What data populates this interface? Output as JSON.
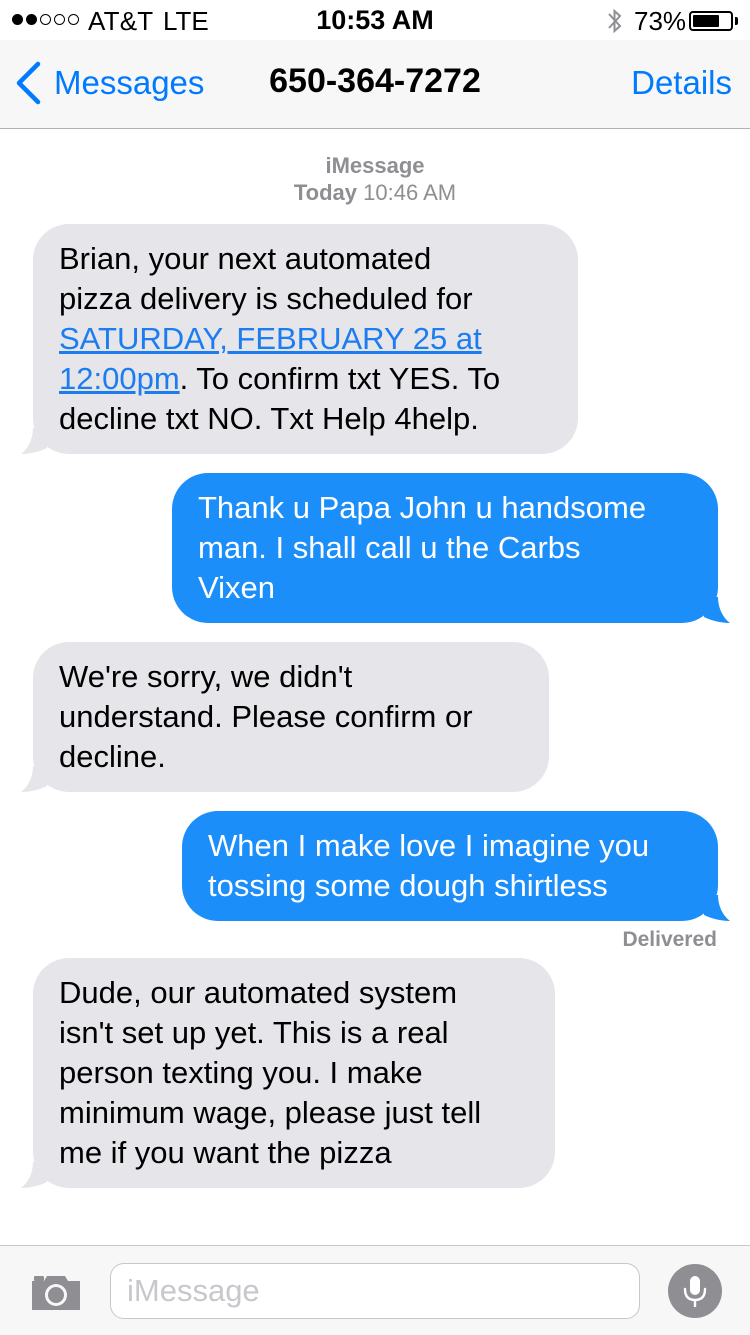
{
  "status_bar": {
    "carrier": "AT&T",
    "network": "LTE",
    "time": "10:53 AM",
    "battery_percent": "73%",
    "battery_level": 0.73,
    "signal_bars": 2,
    "signal_total": 5,
    "icons": [
      "signal-dots-icon",
      "bluetooth-icon",
      "battery-icon"
    ]
  },
  "nav": {
    "back_label": "Messages",
    "title": "650-364-7272",
    "details_label": "Details",
    "icons": [
      "back-chevron-icon"
    ]
  },
  "thread": {
    "service": "iMessage",
    "timestamp_day": "Today",
    "timestamp_time": "10:46 AM",
    "messages": [
      {
        "direction": "incoming",
        "lines": [
          "Brian, your next automated",
          "pizza delivery is scheduled for"
        ],
        "link_lines": [
          "SATURDAY, FEBRUARY 25 at",
          "12:00pm"
        ],
        "after_link": ". To confirm txt YES. To",
        "tail_lines": [
          "decline txt NO. Txt Help 4help."
        ]
      },
      {
        "direction": "outgoing",
        "lines": [
          "Thank u Papa John u handsome",
          "man. I shall call u the Carbs",
          "Vixen"
        ]
      },
      {
        "direction": "incoming",
        "lines": [
          "We're sorry, we didn't",
          "understand. Please confirm or",
          "decline."
        ]
      },
      {
        "direction": "outgoing",
        "lines": [
          "When I make love I imagine you",
          "tossing some dough shirtless"
        ]
      },
      {
        "direction": "incoming",
        "lines": [
          "Dude, our automated system",
          "isn't set up yet. This is a real",
          "person texting you. I make",
          "minimum wage, please just tell",
          "me if you want the pizza"
        ]
      }
    ],
    "delivered_label": "Delivered"
  },
  "input_bar": {
    "placeholder": "iMessage",
    "value": "",
    "icons": [
      "camera-icon",
      "microphone-icon"
    ]
  },
  "colors": {
    "accent": "#007aff",
    "outgoing_bubble": "#1b8efa",
    "incoming_bubble": "#e5e5ea",
    "secondary_text": "#8e8e93"
  }
}
